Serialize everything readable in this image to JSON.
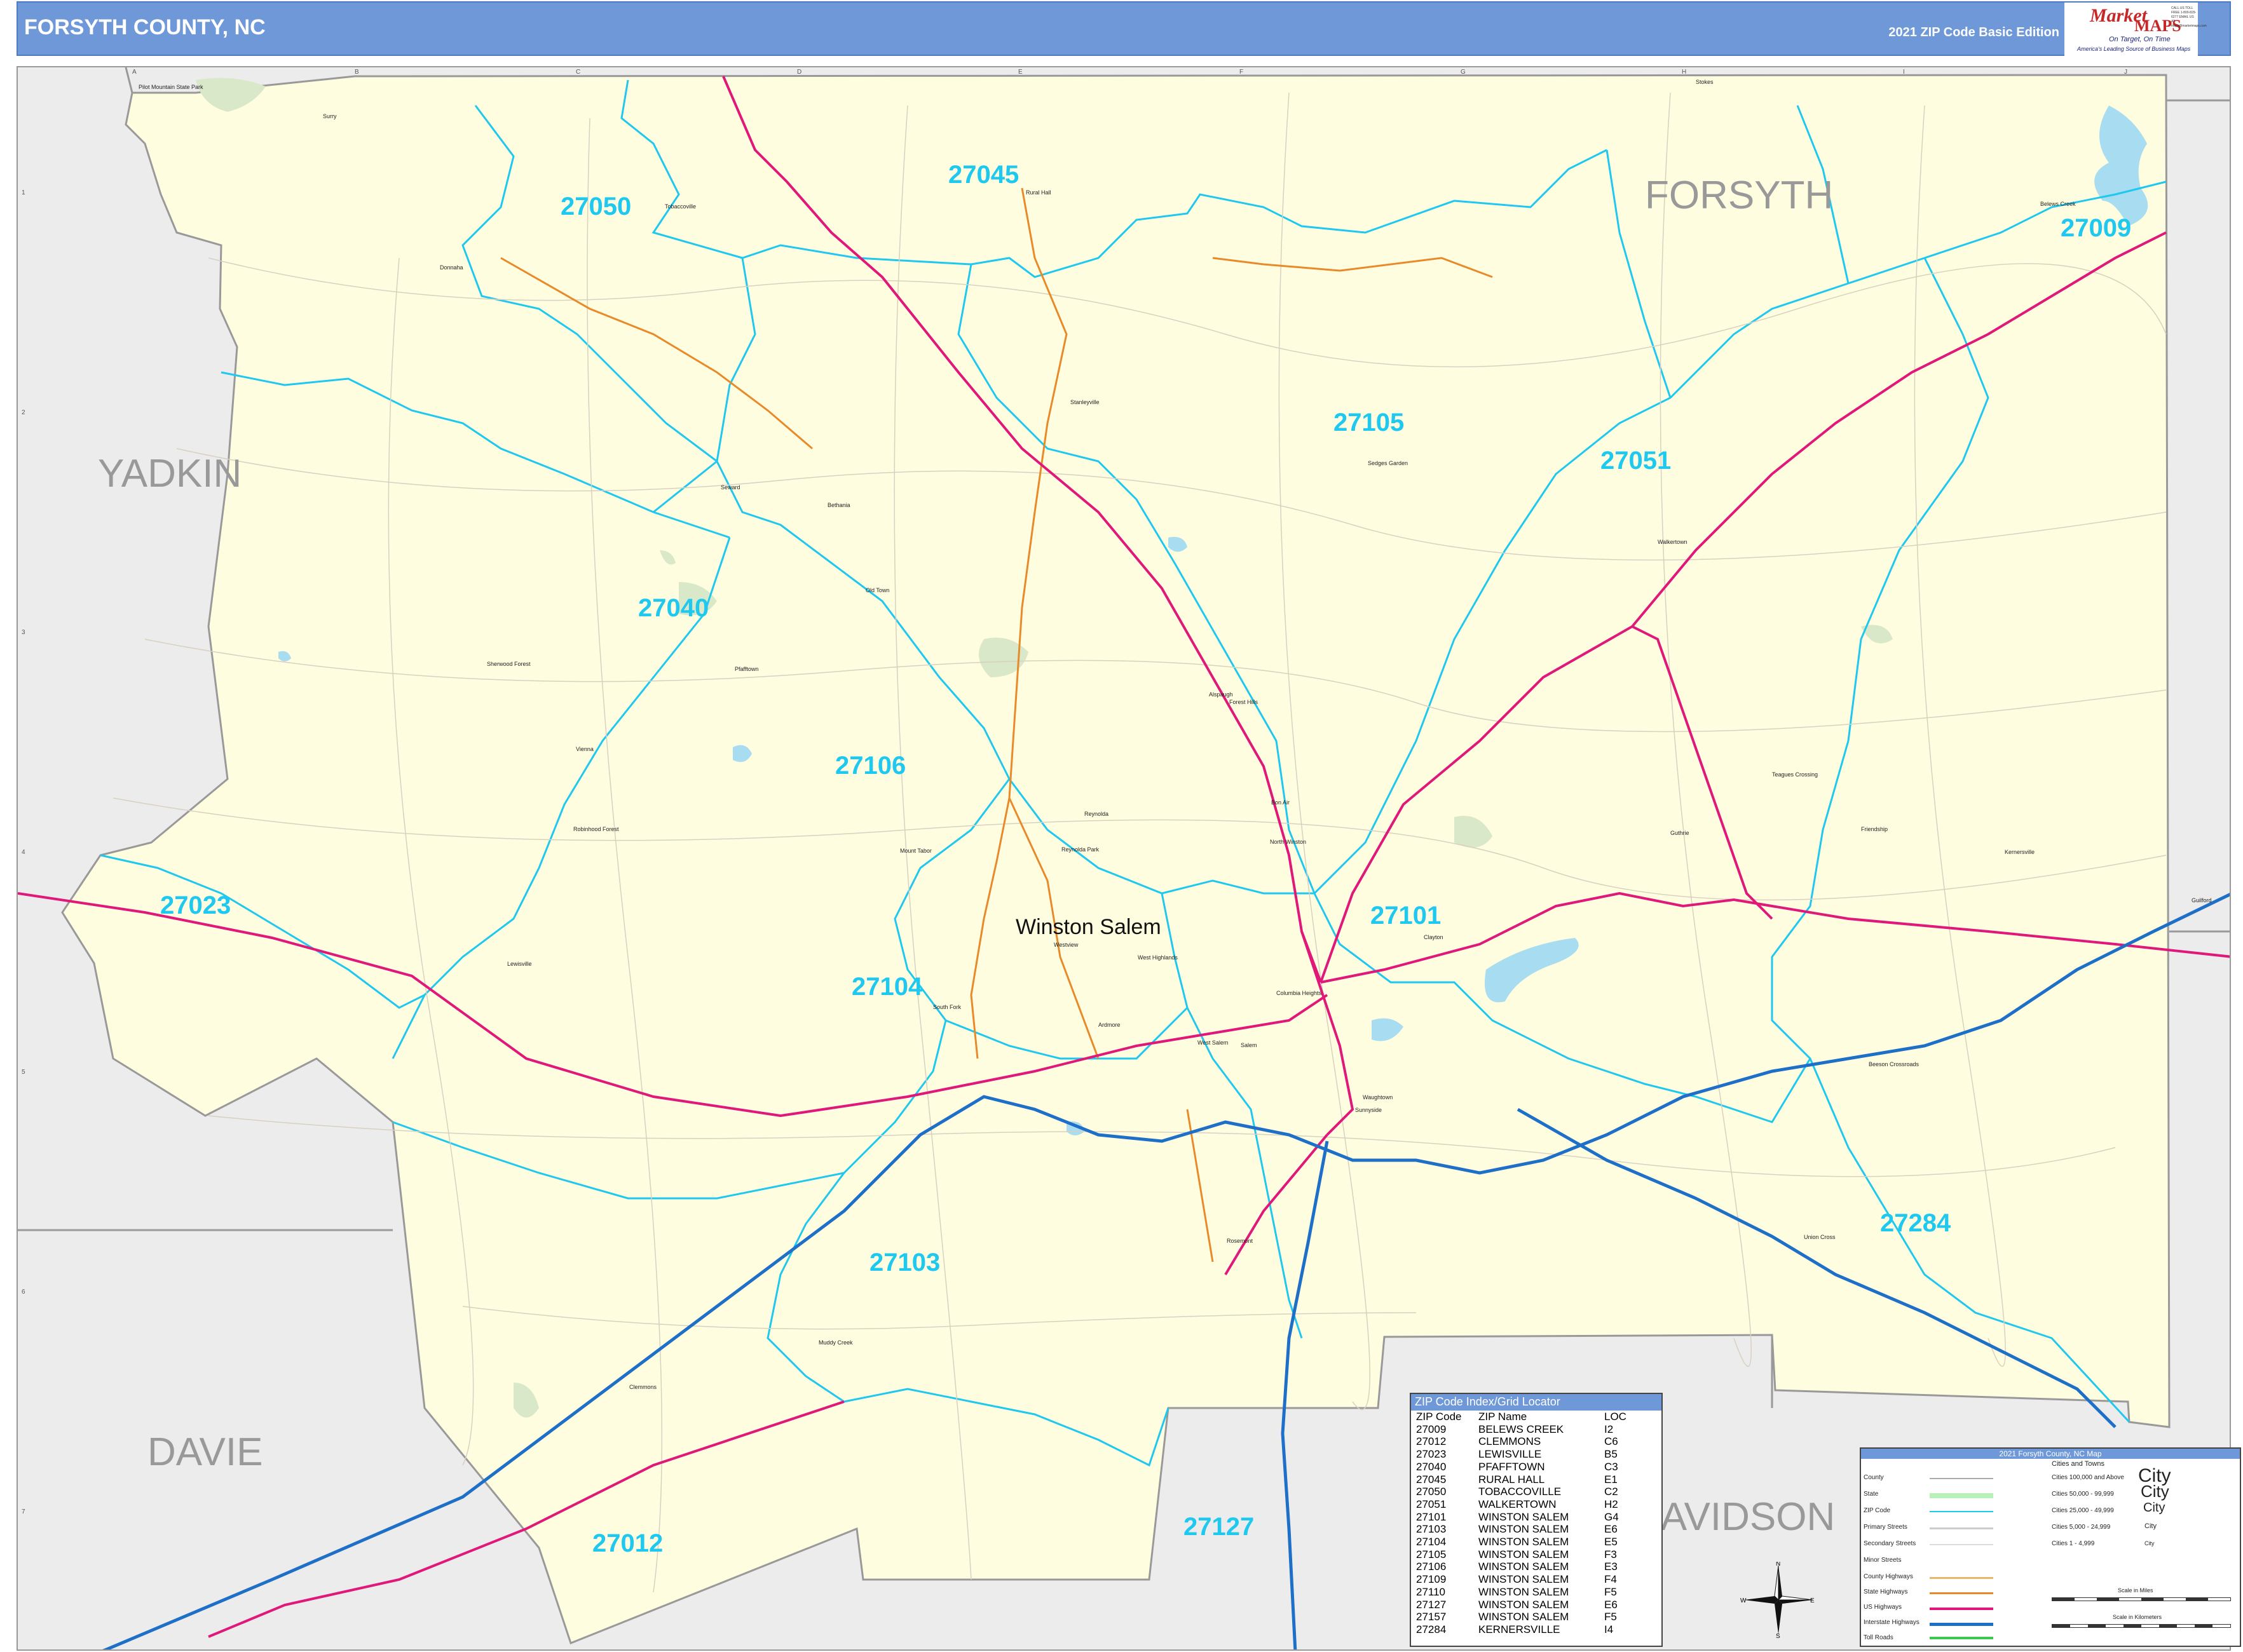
{
  "header": {
    "title": "FORSYTH COUNTY, NC",
    "edition": "2021 ZIP Code Basic Edition"
  },
  "logo": {
    "brand_market": "Market",
    "brand_maps": "MAPS",
    "tagline": "On Target, On Time",
    "slogan": "America's Leading Source of Business Maps",
    "contact": "CALL US TOLL FREE 1-800-829-6277 EMAIL US AT: maps@marketmaps.com"
  },
  "colors": {
    "header_bg": "#6e98d8",
    "county_fill": "#fffde0",
    "outside_fill": "#ececec",
    "zip_boundary": "#1ec8ee",
    "zip_label": "#1ec8ee",
    "interstate": "#1e6fc8",
    "us_highway": "#e0187a",
    "state_highway": "#e88a2a",
    "county_border": "#999999",
    "water": "#a8dcf0",
    "park": "#d8e8c8"
  },
  "map": {
    "county_labels": [
      "YADKIN",
      "FORSYTH",
      "DAVIE",
      "DAVIDSON"
    ],
    "city_label": "Winston Salem",
    "zip_labels": [
      "27050",
      "27045",
      "27009",
      "27105",
      "27051",
      "27040",
      "27106",
      "27023",
      "27101",
      "27104",
      "27103",
      "27284",
      "27012",
      "27127"
    ],
    "towns": [
      "Tobaccoville",
      "Rural Hall",
      "Belews Creek",
      "Donnaha",
      "Stanleyville",
      "Bethania",
      "Seward",
      "Sedges Garden",
      "Walkertown",
      "Old Town",
      "Pfafftown",
      "Sherwood Forest",
      "Vienna",
      "Robinhood Forest",
      "Mount Tabor",
      "Reynolda",
      "Reynolda Park",
      "Alspaugh",
      "Forest Hills",
      "Bon Air",
      "North Winston",
      "Lewisville",
      "Westview",
      "West Highlands",
      "South Fork",
      "Ardmore",
      "West Salem",
      "Salem",
      "Columbia Heights",
      "Clemmons",
      "Muddy Creek",
      "Rosemont",
      "Waughtown",
      "Sunnyside",
      "Union Cross",
      "Teagues Crossing",
      "Guthrie",
      "Kernersville",
      "Friendship",
      "Beeson Crossroads",
      "Clayton",
      "Pilot Mountain State Park",
      "Surry",
      "Stokes",
      "Guilford"
    ],
    "grid_columns": [
      "A",
      "B",
      "C",
      "D",
      "E",
      "F",
      "G",
      "H",
      "I",
      "J"
    ],
    "grid_rows": [
      "1",
      "2",
      "3",
      "4",
      "5",
      "6",
      "7"
    ]
  },
  "index": {
    "title": "ZIP Code Index/Grid Locator",
    "headers": [
      "ZIP Code",
      "ZIP Name",
      "LOC"
    ],
    "rows": [
      [
        "27009",
        "BELEWS CREEK",
        "I2"
      ],
      [
        "27012",
        "CLEMMONS",
        "C6"
      ],
      [
        "27023",
        "LEWISVILLE",
        "B5"
      ],
      [
        "27040",
        "PFAFFTOWN",
        "C3"
      ],
      [
        "27045",
        "RURAL HALL",
        "E1"
      ],
      [
        "27050",
        "TOBACCOVILLE",
        "C2"
      ],
      [
        "27051",
        "WALKERTOWN",
        "H2"
      ],
      [
        "27101",
        "WINSTON SALEM",
        "G4"
      ],
      [
        "27103",
        "WINSTON SALEM",
        "E6"
      ],
      [
        "27104",
        "WINSTON SALEM",
        "E5"
      ],
      [
        "27105",
        "WINSTON SALEM",
        "F3"
      ],
      [
        "27106",
        "WINSTON SALEM",
        "E3"
      ],
      [
        "27109",
        "WINSTON SALEM",
        "F4"
      ],
      [
        "27110",
        "WINSTON SALEM",
        "F5"
      ],
      [
        "27127",
        "WINSTON SALEM",
        "E6"
      ],
      [
        "27157",
        "WINSTON SALEM",
        "F5"
      ],
      [
        "27284",
        "KERNERSVILLE",
        "I4"
      ]
    ]
  },
  "legend": {
    "title": "2021 Forsyth County, NC Map",
    "cities_title": "Cities and Towns",
    "items": [
      "County",
      "State",
      "ZIP Code",
      "Primary Streets",
      "Secondary Streets",
      "Minor Streets",
      "County Highways",
      "State Highways",
      "US Highways",
      "Interstate Highways",
      "Toll Roads"
    ],
    "city_tiers": [
      "Cities 100,000 and Above",
      "Cities 50,000 - 99,999",
      "Cities 25,000 - 49,999",
      "Cities 5,000 - 24,999",
      "Cities 1 - 4,999"
    ],
    "city_samples": [
      "City",
      "City",
      "City",
      "City",
      "City"
    ],
    "scale_miles": "Scale in Miles",
    "scale_km": "Scale in Kilometers"
  },
  "compass": {
    "n": "N",
    "s": "S",
    "e": "E",
    "w": "W"
  }
}
